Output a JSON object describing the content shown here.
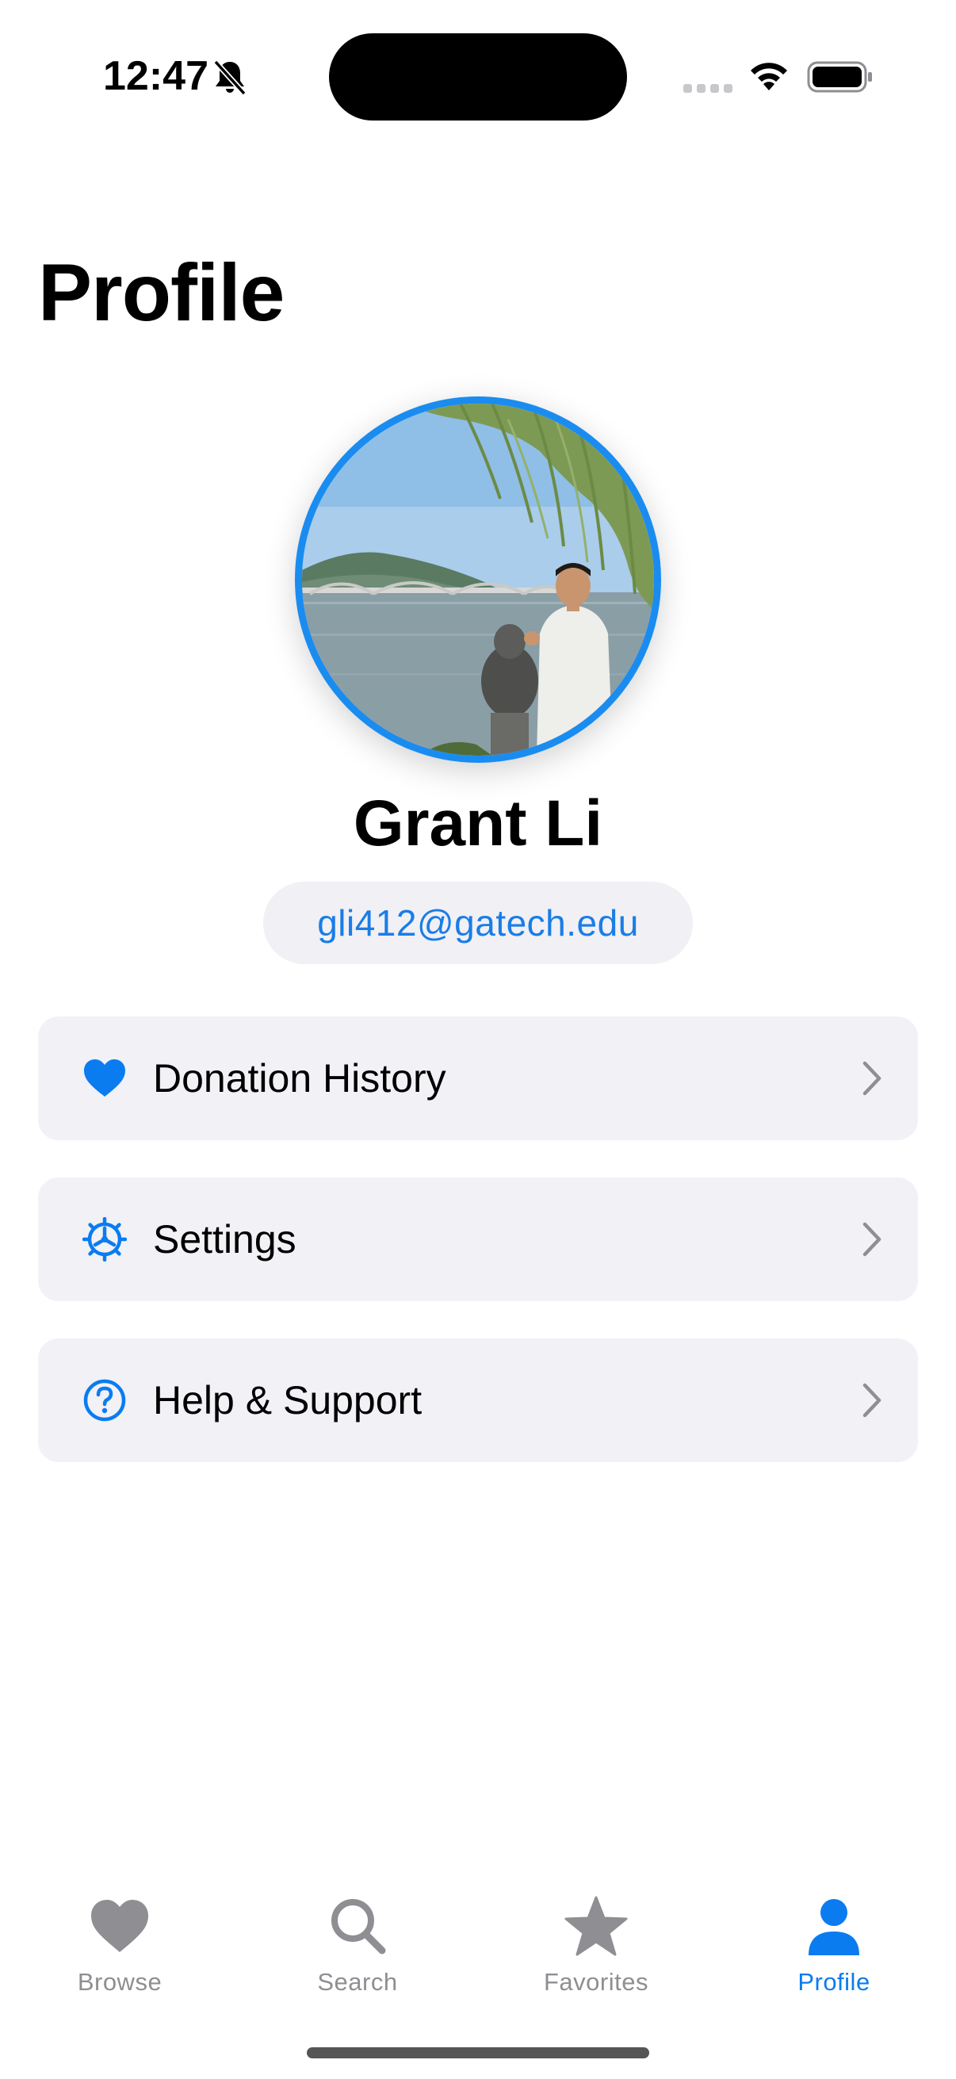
{
  "status_bar": {
    "time": "12:47",
    "silent_icon": "bell-slash-icon",
    "signal_icon": "cellular-signal-icon",
    "wifi_icon": "wifi-icon",
    "battery_icon": "battery-full-icon"
  },
  "header": {
    "title": "Profile"
  },
  "profile": {
    "avatar_icon": "profile-photo",
    "name": "Grant Li",
    "email": "gli412@gatech.edu"
  },
  "menu": {
    "items": [
      {
        "label": "Donation History",
        "icon": "heart-icon"
      },
      {
        "label": "Settings",
        "icon": "gear-icon"
      },
      {
        "label": "Help & Support",
        "icon": "question-circle-icon"
      }
    ]
  },
  "tab_bar": {
    "tabs": [
      {
        "label": "Browse",
        "icon": "heart-icon",
        "active": false
      },
      {
        "label": "Search",
        "icon": "magnifier-icon",
        "active": false
      },
      {
        "label": "Favorites",
        "icon": "star-icon",
        "active": false
      },
      {
        "label": "Profile",
        "icon": "person-icon",
        "active": true
      }
    ]
  },
  "colors": {
    "accent": "#0a7cf0",
    "inactive_tab": "#8e8e93",
    "row_background": "#f1f1f6",
    "avatar_ring": "#1a8cf0"
  }
}
